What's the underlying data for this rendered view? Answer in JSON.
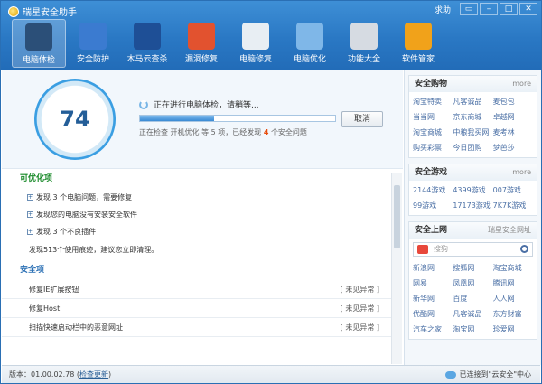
{
  "app": {
    "title": "瑞星安全助手",
    "help": "求助"
  },
  "window_controls": [
    "▭",
    "–",
    "□",
    "✕"
  ],
  "tabs": [
    {
      "label": "电脑体检",
      "icon": "monitor-icon",
      "color": "#2b4f78"
    },
    {
      "label": "安全防护",
      "icon": "firewall-icon",
      "color": "#3b7bd0"
    },
    {
      "label": "木马云查杀",
      "icon": "shield-icon",
      "color": "#1e4f96"
    },
    {
      "label": "漏洞修复",
      "icon": "windows-icon",
      "color": "#e2522f"
    },
    {
      "label": "电脑修复",
      "icon": "checklist-icon",
      "color": "#e8eef3"
    },
    {
      "label": "电脑优化",
      "icon": "optimize-icon",
      "color": "#7fb7e8"
    },
    {
      "label": "功能大全",
      "icon": "disc-icon",
      "color": "#d6dbe2"
    },
    {
      "label": "软件管家",
      "icon": "software-icon",
      "color": "#f1a21a"
    }
  ],
  "scan": {
    "score": "74",
    "status": "正在进行电脑体检，请稍等...",
    "progress": 0.38,
    "detail_pre": "正在检查 开机优化 等 5 项，已经发现",
    "detail_count": "4",
    "detail_post": "个安全问题",
    "cancel": "取消"
  },
  "optimize": {
    "title": "可优化项",
    "items": [
      "发现 3 个电脑问题，需要修复",
      "发现您的电脑没有安装安全软件",
      "发现 3 个不良插件"
    ],
    "note": "发现513个使用痕迹，建议您立即清理。"
  },
  "safe": {
    "title": "安全项",
    "rows": [
      {
        "label": "修复IE扩展按钮",
        "state": "[ 未见异常 ]"
      },
      {
        "label": "修复Host",
        "state": "[ 未见异常 ]"
      },
      {
        "label": "扫描快速启动栏中的恶意网址",
        "state": "[ 未见异常 ]"
      }
    ]
  },
  "sidebar": {
    "shop": {
      "title": "安全购物",
      "more": "more",
      "links": [
        "淘宝特卖",
        "凡客诚品",
        "麦包包",
        "当当网",
        "京东商城",
        "卓越网",
        "淘宝商城",
        "中粮我买网",
        "麦考林",
        "购买彩票",
        "今日团购",
        "梦芭莎"
      ]
    },
    "games": {
      "title": "安全游戏",
      "more": "more",
      "links": [
        "2144游戏",
        "4399游戏",
        "007游戏",
        "99游戏",
        "17173游戏",
        "7K7K游戏"
      ]
    },
    "web": {
      "title": "安全上网",
      "more": "瑞星安全网址",
      "search_placeholder": "搜狗",
      "links": [
        "新浪网",
        "搜狐网",
        "淘宝商城",
        "网易",
        "凤凰网",
        "腾讯网",
        "新华网",
        "百度",
        "人人网",
        "优酷网",
        "凡客诚品",
        "东方财富",
        "汽车之家",
        "淘宝网",
        "珍爱网"
      ]
    }
  },
  "status": {
    "version": "版本：01.00.02.78",
    "update": "检查更新",
    "cloud": "已连接到\"云安全\"中心"
  }
}
